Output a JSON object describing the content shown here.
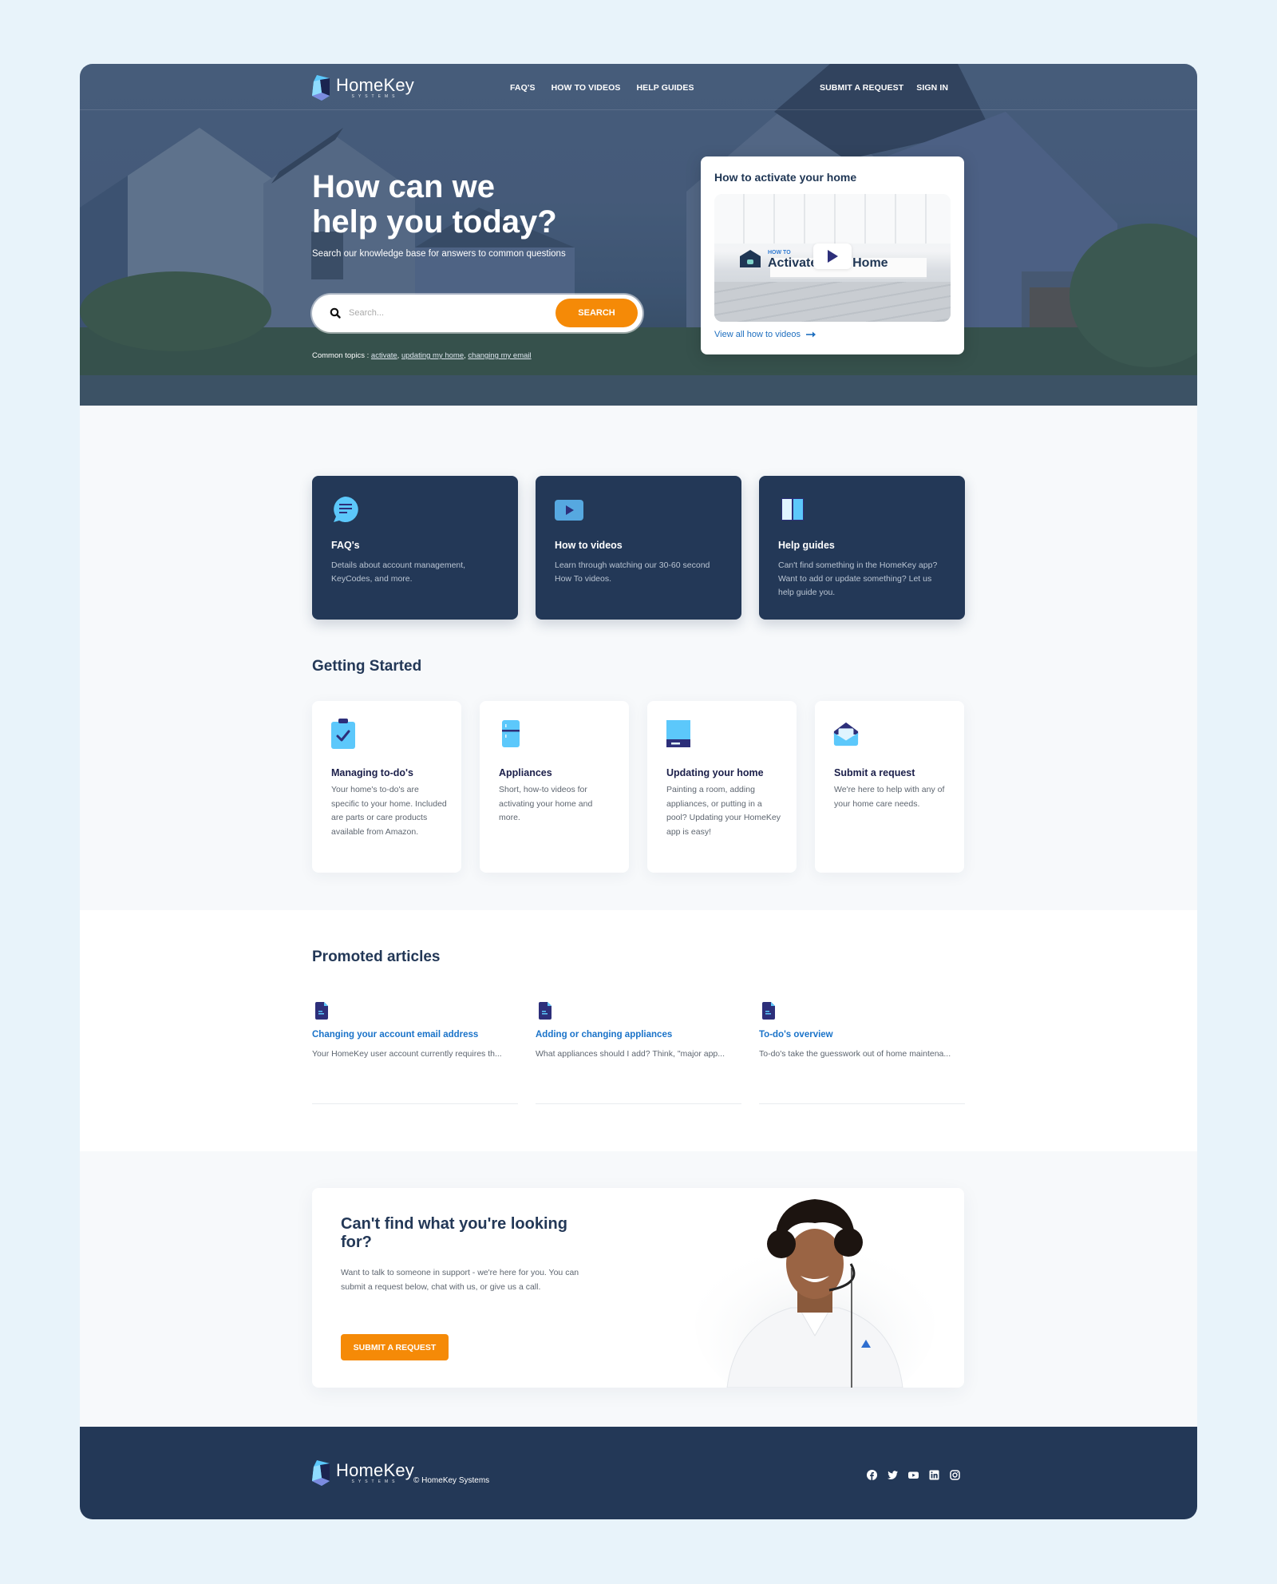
{
  "brand": {
    "name": "HomeKey",
    "sub": "SYSTEMS"
  },
  "nav": {
    "left": [
      "FAQ'S",
      "HOW TO VIDEOS",
      "HELP GUIDES"
    ],
    "right": [
      "SUBMIT A REQUEST",
      "SIGN IN"
    ]
  },
  "hero": {
    "title_line1": "How can we",
    "title_line2": "help you today?",
    "subtitle": "Search our knowledge base for answers to common questions",
    "search_placeholder": "Search...",
    "search_value": "",
    "search_button": "SEARCH",
    "topics_label": "Common topics : ",
    "topics": [
      "activate",
      "updating my home",
      "changing my email"
    ]
  },
  "video_card": {
    "title": "How to activate your home",
    "thumb_kicker": "HOW TO",
    "thumb_title": "Activate Your Home",
    "link": "View all how to videos",
    "link_icon": "arrow-right-icon"
  },
  "categories": [
    {
      "icon": "chat-bubble-icon",
      "title": "FAQ's",
      "desc": "Details about account management, KeyCodes, and more."
    },
    {
      "icon": "video-play-icon",
      "title": "How to videos",
      "desc": "Learn through watching our 30-60 second How To videos."
    },
    {
      "icon": "book-icon",
      "title": "Help guides",
      "desc": "Can't find something in the HomeKey app? Want to add or update something? Let us help guide you."
    }
  ],
  "getting_started": {
    "title": "Getting Started",
    "items": [
      {
        "icon": "clipboard-check-icon",
        "title": "Managing to-do's",
        "desc": "Your home's to-do's are specific to your home. Included are parts or care products available from Amazon."
      },
      {
        "icon": "refrigerator-icon",
        "title": "Appliances",
        "desc": "Short, how-to videos for activating your home and more."
      },
      {
        "icon": "drawer-icon",
        "title": "Updating your home",
        "desc": "Painting a room, adding appliances, or putting in a pool? Updating your HomeKey app is easy!"
      },
      {
        "icon": "envelope-open-icon",
        "title": "Submit a request",
        "desc": "We're here to help with any of your home care needs."
      }
    ]
  },
  "promoted": {
    "title": "Promoted articles",
    "articles": [
      {
        "title": "Changing your account email address",
        "excerpt": "Your HomeKey user account currently requires th..."
      },
      {
        "title": "Adding or changing appliances",
        "excerpt": "What appliances should I add? Think, \"major app..."
      },
      {
        "title": "To-do's overview",
        "excerpt": "To-do's take the guesswork out of home maintena..."
      }
    ]
  },
  "cta": {
    "title": "Can't find what you're looking for?",
    "body": "Want to talk to someone in support - we're here for you. You can submit a request below, chat with us, or give us a call.",
    "button": "SUBMIT A REQUEST"
  },
  "footer": {
    "copyright": "© HomeKey Systems",
    "social": [
      "facebook-icon",
      "twitter-icon",
      "youtube-icon",
      "linkedin-icon",
      "instagram-icon"
    ]
  },
  "colors": {
    "navy": "#233857",
    "accent_orange": "#f58a07",
    "link_blue": "#1a73c9",
    "icon_light_blue": "#5cc8fb",
    "icon_dark": "#2d2f7a",
    "page_bg": "#e8f3fa"
  }
}
